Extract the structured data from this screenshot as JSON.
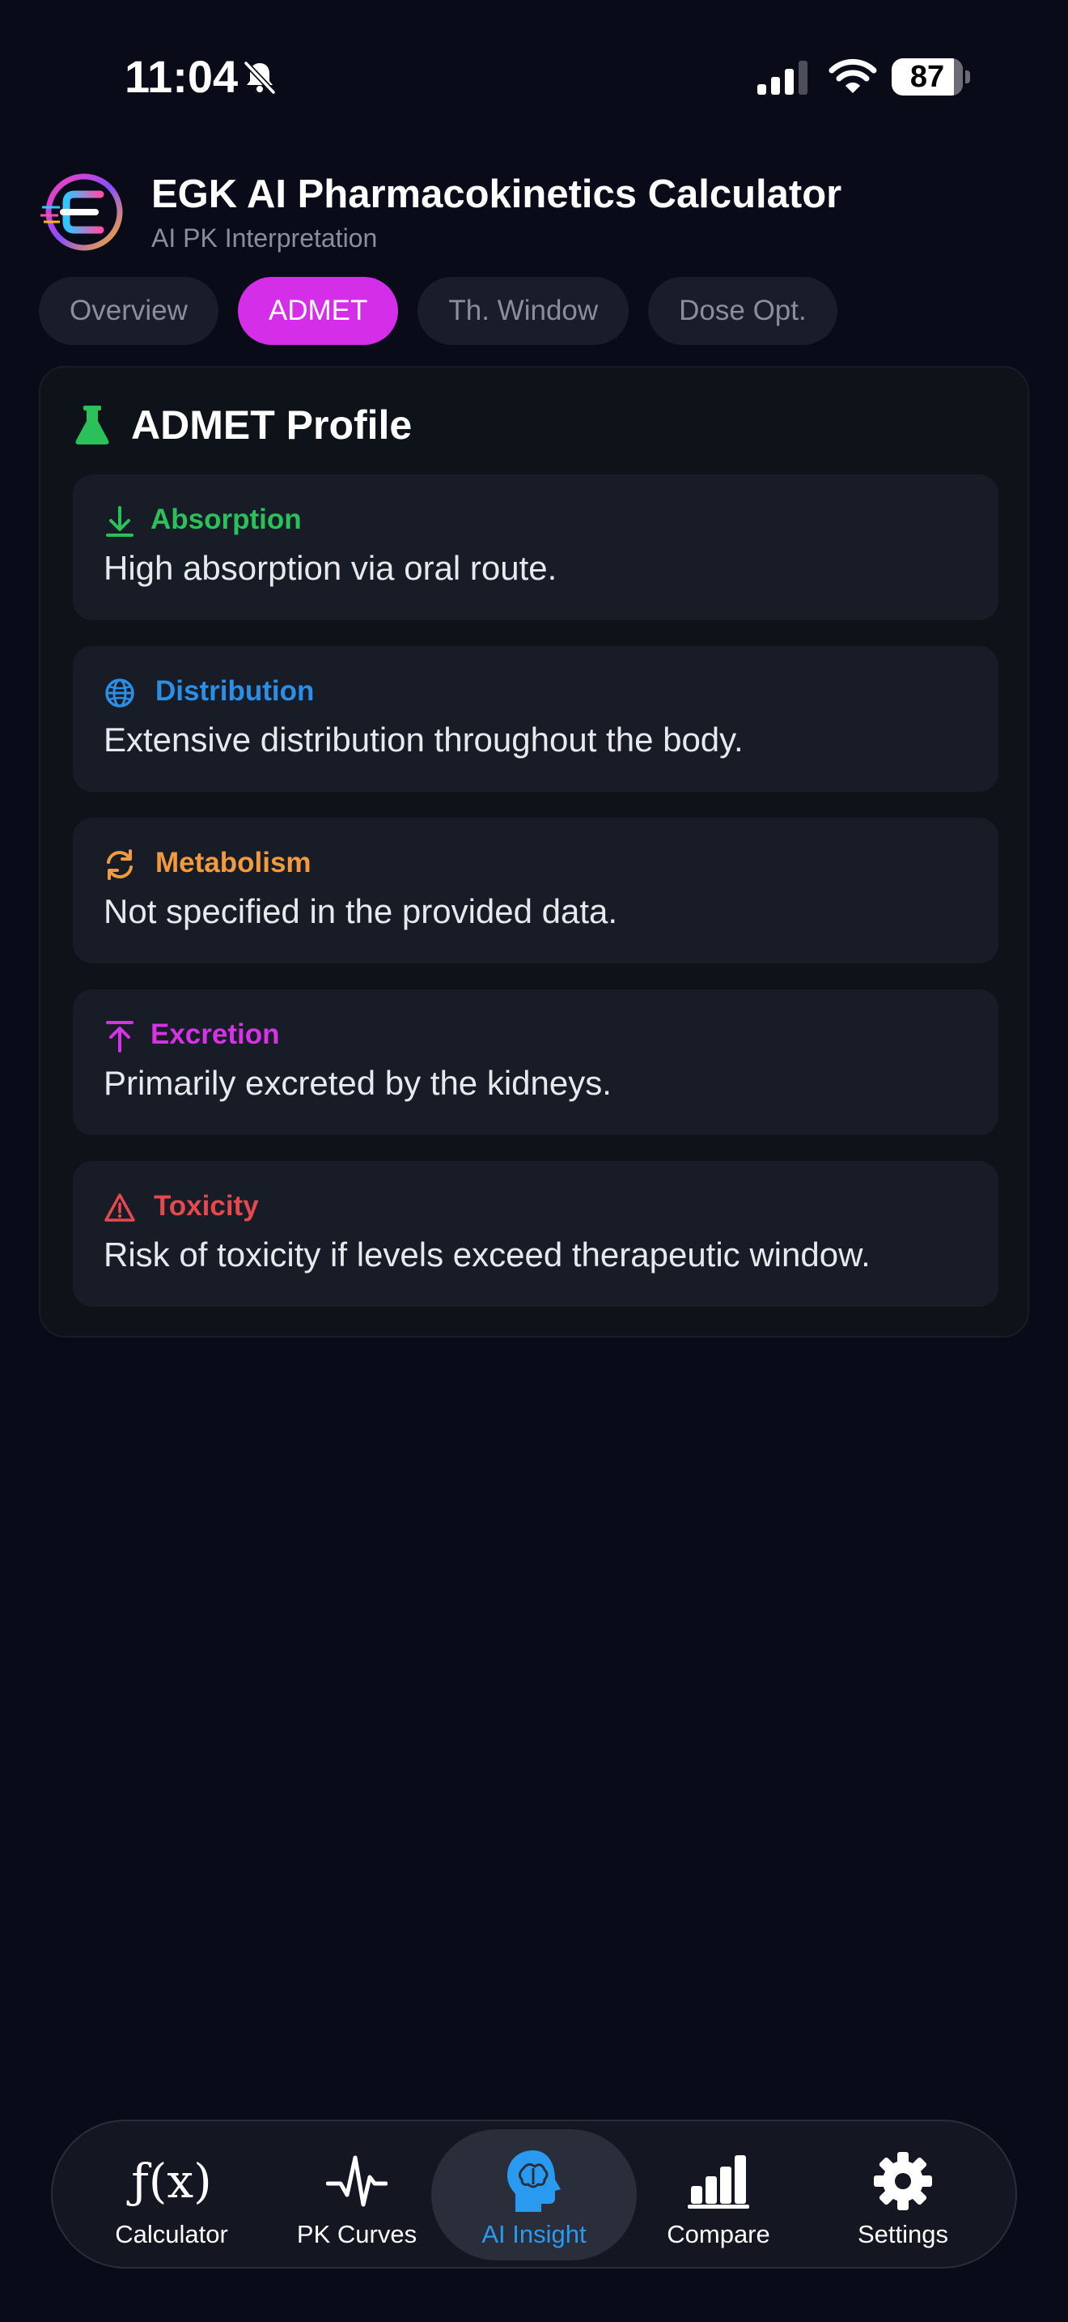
{
  "status_bar": {
    "time": "11:04",
    "battery_level": "87",
    "battery_fraction": 0.87,
    "icons": [
      "bell-slash-icon",
      "cellular-signal-icon",
      "wifi-icon",
      "battery-icon"
    ]
  },
  "header": {
    "logo_icon": "egk-logo-icon",
    "title": "EGK AI Pharmacokinetics Calculator",
    "subtitle": "AI PK Interpretation"
  },
  "tabs": [
    {
      "label": "Overview",
      "active": false
    },
    {
      "label": "ADMET",
      "active": true
    },
    {
      "label": "Th. Window",
      "active": false
    },
    {
      "label": "Dose Opt.",
      "active": false
    }
  ],
  "admet": {
    "title": "ADMET Profile",
    "title_icon": "flask-icon",
    "title_icon_color": "#2bc15a",
    "items": [
      {
        "label": "Absorption",
        "text": "High absorption via oral route.",
        "icon": "arrow-down-to-line-icon",
        "color": "#2bc15a"
      },
      {
        "label": "Distribution",
        "text": "Extensive distribution throughout the body.",
        "icon": "globe-icon",
        "color": "#2a8fe6"
      },
      {
        "label": "Metabolism",
        "text": "Not specified in the provided data.",
        "icon": "refresh-icon",
        "color": "#f19a3e"
      },
      {
        "label": "Excretion",
        "text": "Primarily excreted by the kidneys.",
        "icon": "arrow-up-from-line-icon",
        "color": "#d633e6"
      },
      {
        "label": "Toxicity",
        "text": "Risk of toxicity if levels exceed therapeutic window.",
        "icon": "warning-triangle-icon",
        "color": "#e5484d"
      }
    ]
  },
  "bottom_nav": [
    {
      "label": "Calculator",
      "icon": "function-icon",
      "icon_text": "ƒ(x)",
      "active": false
    },
    {
      "label": "PK Curves",
      "icon": "waveform-icon",
      "active": false
    },
    {
      "label": "AI Insight",
      "icon": "brain-head-icon",
      "active": true
    },
    {
      "label": "Compare",
      "icon": "bar-chart-icon",
      "active": false
    },
    {
      "label": "Settings",
      "icon": "gear-icon",
      "active": false
    }
  ],
  "colors": {
    "background": "#0a0b18",
    "accent_magenta": "#d52ee8",
    "accent_blue": "#2a9af0"
  }
}
